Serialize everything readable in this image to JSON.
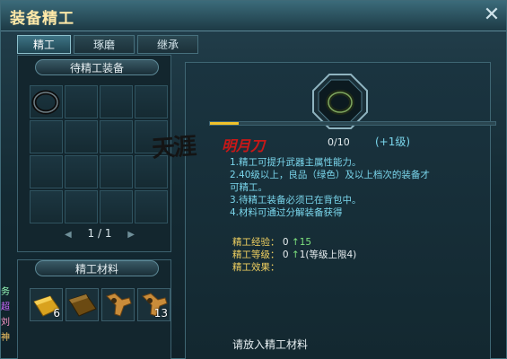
{
  "window": {
    "title": "装备精工"
  },
  "tabs": [
    {
      "label": "精工",
      "active": true
    },
    {
      "label": "琢磨",
      "active": false
    },
    {
      "label": "继承",
      "active": false
    }
  ],
  "equip_panel": {
    "label": "待精工装备",
    "page": "1 / 1"
  },
  "materials_panel": {
    "label": "精工材料",
    "items": [
      {
        "icon": "gold-bar-icon",
        "count": "6"
      },
      {
        "icon": "bronze-bar-icon",
        "count": ""
      },
      {
        "icon": "wrench-icon",
        "count": ""
      },
      {
        "icon": "wrench-icon",
        "count": "13"
      }
    ]
  },
  "refine": {
    "progress": "0/10",
    "progress_fraction": 0.1,
    "level_up": "(+1级)",
    "rules": [
      "1.精工可提升武器主属性能力。",
      "2.40级以上，良品（绿色）及以上档次的装备才",
      "可精工。",
      "3.待精工装备必须已在背包中。",
      "4.材料可通过分解装备获得"
    ],
    "stats": {
      "exp_label": "精工经验：",
      "exp_value": "0",
      "exp_gain": "15",
      "level_label": "精工等级：",
      "level_value": "0",
      "level_gain": "1(等级上限4)",
      "effect_label": "精工效果："
    },
    "put_material": "请放入精工材料"
  },
  "watermark": {
    "text": "天涯明月刀"
  },
  "colors": {
    "title": "#ffe9a8",
    "rules": "#7ad6ec",
    "stat_label": "#f0d060",
    "gain": "#7ee27e",
    "bar": "#f0c22a"
  }
}
